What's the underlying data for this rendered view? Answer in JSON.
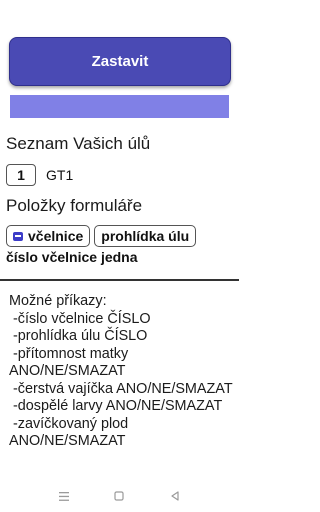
{
  "header": {
    "stop_label": "Zastavit"
  },
  "progress": {
    "value": 1.0,
    "color": "#8080e6"
  },
  "hives": {
    "title": "Seznam Vašich úlů",
    "items": [
      {
        "number": "1",
        "name": "GT1"
      }
    ]
  },
  "form": {
    "title": "Položky formuláře",
    "chips": [
      {
        "label": "včelnice",
        "icon": "chat-icon"
      },
      {
        "label": "prohlídka úlu"
      }
    ],
    "selected": "číslo včelnice jedna"
  },
  "commands": {
    "text": "Možné příkazy:\n -číslo včelnice ČÍSLO\n -prohlídka úlu ČÍSLO\n -přítomnost matky ANO/NE/SMAZAT\n -čerstvá vajíčka ANO/NE/SMAZAT\n -dospělé larvy ANO/NE/SMAZAT\n -zavíčkovaný plod ANO/NE/SMAZAT"
  },
  "nav": {
    "menu_icon": "menu-icon",
    "home_icon": "home-icon",
    "back_icon": "back-icon"
  },
  "colors": {
    "accent": "#4a4ab4",
    "progress": "#8080e6"
  }
}
